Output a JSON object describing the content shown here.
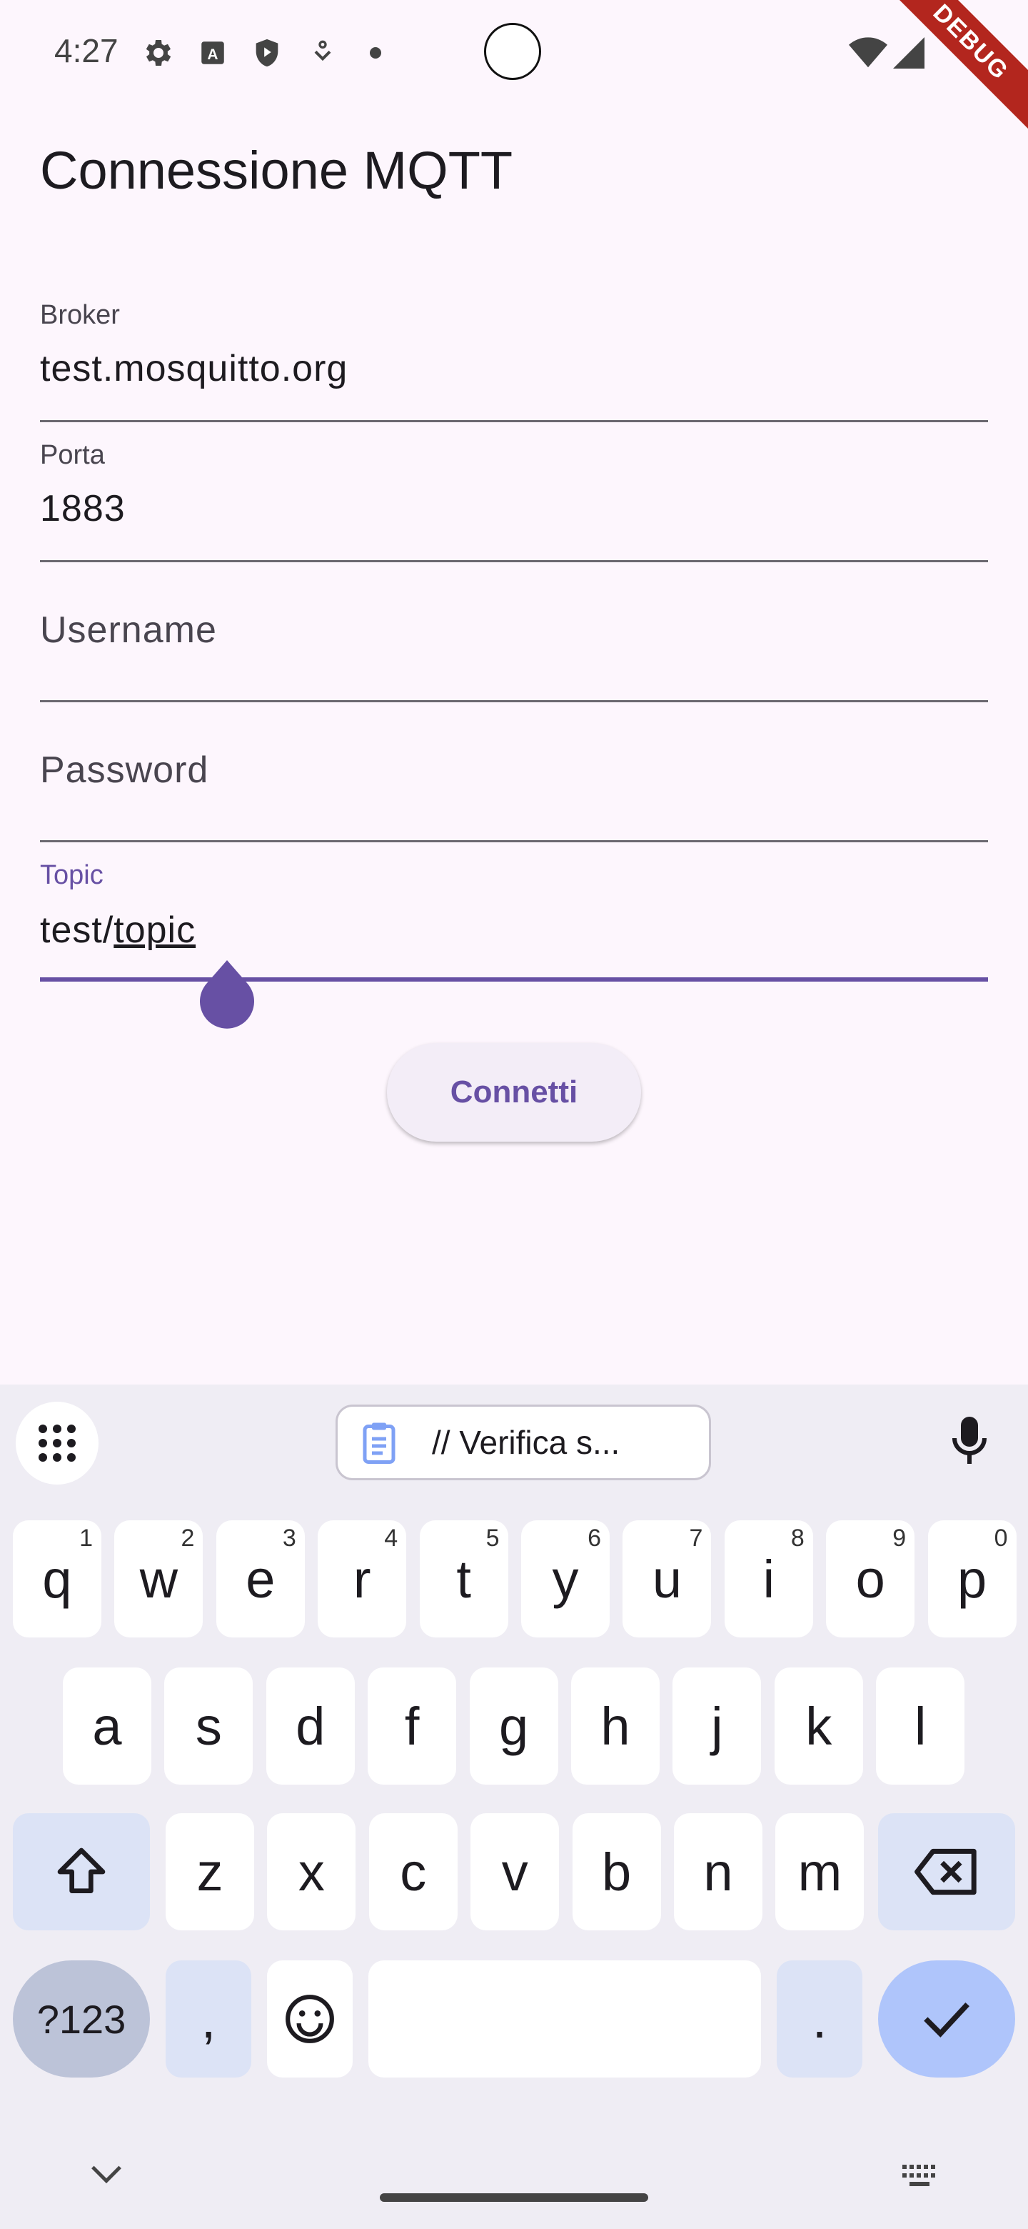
{
  "status_bar": {
    "time": "4:27",
    "debug_label": "DEBUG"
  },
  "page": {
    "title": "Connessione MQTT"
  },
  "form": {
    "broker": {
      "label": "Broker",
      "value": "test.mosquitto.org"
    },
    "port": {
      "label": "Porta",
      "value": "1883"
    },
    "username": {
      "placeholder": "Username"
    },
    "password": {
      "placeholder": "Password"
    },
    "topic": {
      "label": "Topic",
      "value_prefix": "test/",
      "value_composing": "topic"
    },
    "connect_label": "Connetti"
  },
  "keyboard": {
    "clipboard_suggestion": "// Verifica s...",
    "row1": [
      {
        "k": "q",
        "h": "1"
      },
      {
        "k": "w",
        "h": "2"
      },
      {
        "k": "e",
        "h": "3"
      },
      {
        "k": "r",
        "h": "4"
      },
      {
        "k": "t",
        "h": "5"
      },
      {
        "k": "y",
        "h": "6"
      },
      {
        "k": "u",
        "h": "7"
      },
      {
        "k": "i",
        "h": "8"
      },
      {
        "k": "o",
        "h": "9"
      },
      {
        "k": "p",
        "h": "0"
      }
    ],
    "row2": [
      "a",
      "s",
      "d",
      "f",
      "g",
      "h",
      "j",
      "k",
      "l"
    ],
    "row3": [
      "z",
      "x",
      "c",
      "v",
      "b",
      "n",
      "m"
    ],
    "symbols_label": "?123",
    "comma": ",",
    "period": "."
  },
  "colors": {
    "accent": "#6750a4",
    "background": "#fdf6fd",
    "keyboard_bg": "#efedf4"
  }
}
